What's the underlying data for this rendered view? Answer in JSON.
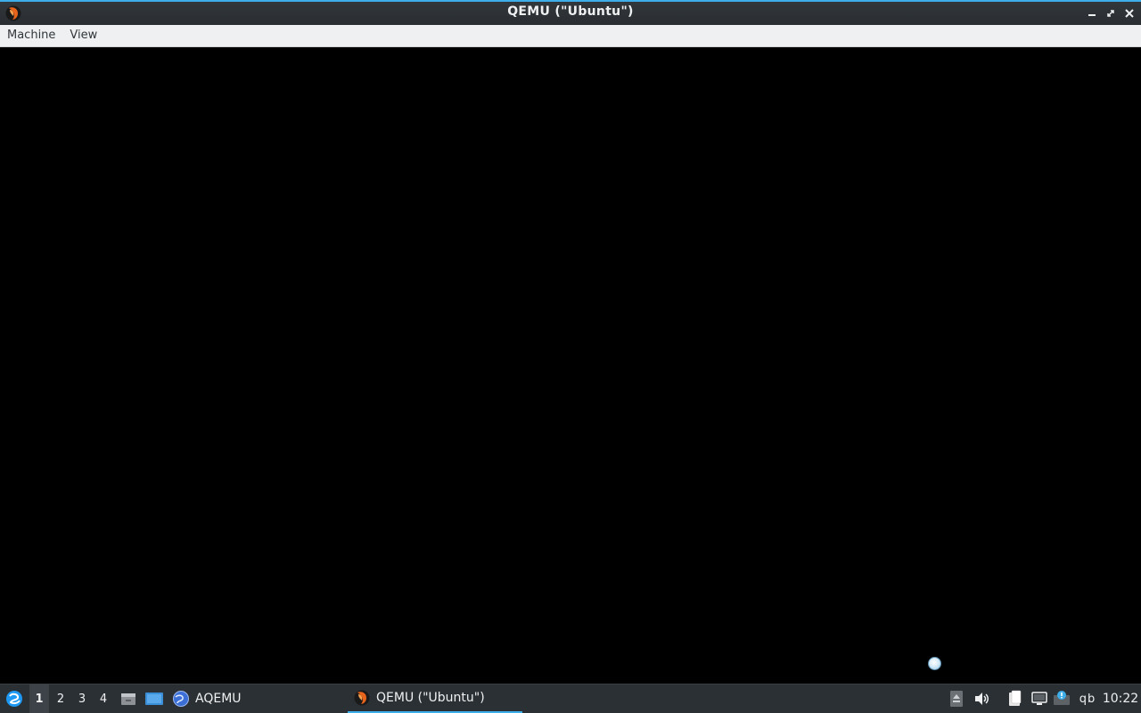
{
  "window": {
    "title": "QEMU (\"Ubuntu\")",
    "app_icon": "qemu-icon",
    "controls": [
      "minimize-icon",
      "maximize-icon",
      "close-icon"
    ]
  },
  "menubar": {
    "items": [
      {
        "label": "Machine"
      },
      {
        "label": "View"
      }
    ]
  },
  "taskbar": {
    "start_icon": "lxqt-start-icon",
    "desktops": [
      "1",
      "2",
      "3",
      "4"
    ],
    "active_desktop": "1",
    "quicklaunch": [
      "file-manager-icon",
      "show-desktop-icon"
    ],
    "tasks": [
      {
        "label": "AQEMU",
        "icon": "aqemu-icon",
        "active": false
      },
      {
        "label": "QEMU (\"Ubuntu\")",
        "icon": "qemu-icon",
        "active": true
      }
    ],
    "tray": [
      "removable-media-icon",
      "volume-icon",
      "clipboard-icon",
      "network-icon",
      "notification-icon"
    ],
    "keyboard_layout": "qb",
    "clock": "10:22"
  },
  "colors": {
    "accent": "#3daee9",
    "titlebar": "#2a2e32",
    "menubar": "#eff0f1",
    "taskbar": "#2b3034",
    "display": "#000000"
  }
}
